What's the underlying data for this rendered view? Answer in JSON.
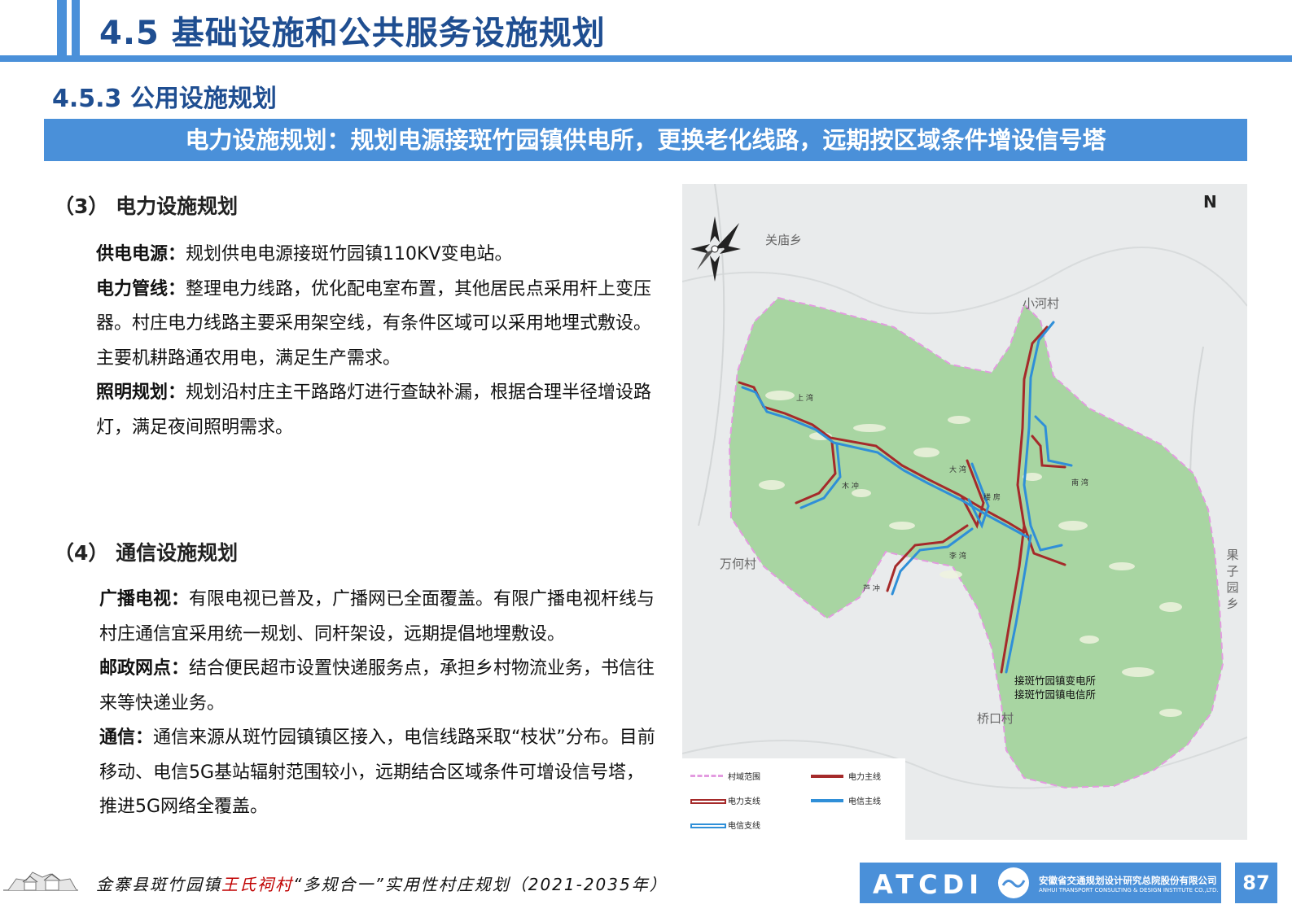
{
  "header": {
    "title": "4.5 基础设施和公共服务设施规划"
  },
  "section": {
    "title": "4.5.3  公用设施规划"
  },
  "banner": {
    "text": "电力设施规划：规划电源接斑竹园镇供电所，更换老化线路，远期按区域条件增设信号塔"
  },
  "power": {
    "heading": "（3） 电力设施规划",
    "p1_label": "供电电源：",
    "p1_text": "规划供电电源接斑竹园镇110KV变电站。",
    "p2_label": "电力管线：",
    "p2_text": "整理电力线路，优化配电室布置，其他居民点采用杆上变压器。村庄电力线路主要采用架空线，有条件区域可以采用地埋式敷设。",
    "p3_text": "主要机耕路通农用电，满足生产需求。",
    "p4_label": "照明规划：",
    "p4_text": "规划沿村庄主干路路灯进行查缺补漏，根据合理半径增设路灯，满足夜间照明需求。"
  },
  "telecom": {
    "heading": "（4） 通信设施规划",
    "p1_label": "广播电视：",
    "p1_text": "有限电视已普及，广播网已全面覆盖。有限广播电视杆线与村庄通信宜采用统一规划、同杆架设，远期提倡地埋敷设。",
    "p2_label": "邮政网点：",
    "p2_text": "结合便民超市设置快递服务点，承担乡村物流业务，书信往来等快递业务。",
    "p3_label": "通信：",
    "p3_text": "通信来源从斑竹园镇镇区接入，电信线路采取“枝状”分布。目前移动、电信5G基站辐射范围较小，远期结合区域条件可增设信号塔，推进5G网络全覆盖。"
  },
  "map": {
    "north": "N",
    "labels": {
      "guanmiao": "关庙乡",
      "xiaohe": "小河村",
      "wanhe": "万何村",
      "guoziyuan": "果子园乡",
      "qiaokou": "桥口村",
      "substation_1": "接斑竹园镇变电所",
      "substation_2": "接斑竹园镇电信所"
    },
    "places": {
      "shangwan": "上 湾",
      "dawan": "大 湾",
      "muchong": "木 冲",
      "loufang": "楼 房",
      "nanwan": "南 湾",
      "liwan": "李 湾",
      "luchong": "芦 冲"
    },
    "legend": [
      {
        "label": "村域范围",
        "color": "#e39be0"
      },
      {
        "label": "电力主线",
        "color": "#a52a2a"
      },
      {
        "label": "电力支线",
        "color": "#a52a2a"
      },
      {
        "label": "电信主线",
        "color": "#2f8fd8"
      },
      {
        "label": "电信支线",
        "color": "#2f8fd8"
      }
    ]
  },
  "footer": {
    "text_a": "金寨县斑竹园镇",
    "text_red": "王氏祠村",
    "text_b": "“多规合一”实用性村庄规划（2021-2035年）",
    "logo": "ATCDI",
    "company_cn": "安徽省交通规划设计研究总院股份有限公司",
    "company_en": "ANHUI TRANSPORT CONSULTING & DESIGN INSTITUTE CO.,LTD.",
    "page": "87"
  },
  "colors": {
    "accent": "#4a90d9",
    "title": "#1f4e91",
    "power": "#a52a2a",
    "telecom": "#2f8fd8",
    "village": "#a8d5a2"
  }
}
